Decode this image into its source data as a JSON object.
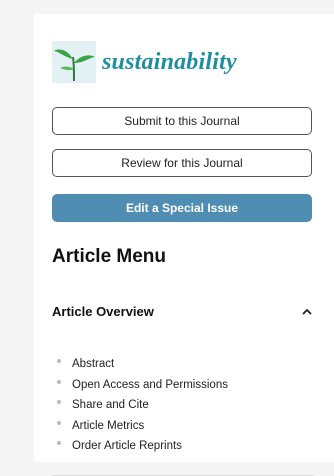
{
  "journal": {
    "logo_text": "sustainability"
  },
  "buttons": {
    "submit_label": "Submit to this Journal",
    "review_label": "Review for this Journal",
    "edit_label": "Edit a Special Issue"
  },
  "article_menu": {
    "title": "Article Menu",
    "overview_section": {
      "title": "Article Overview",
      "expanded": true,
      "items": [
        "Abstract",
        "Open Access and Permissions",
        "Share and Cite",
        "Article Metrics",
        "Order Article Reprints"
      ]
    }
  },
  "colors": {
    "logo_text": "#1e8fa1",
    "edit_button_bg": "#4f8db3",
    "leaf_green": "#3aa349"
  },
  "icons": {
    "logo": "plant-logo-icon",
    "collapse": "chevron-up-icon"
  }
}
